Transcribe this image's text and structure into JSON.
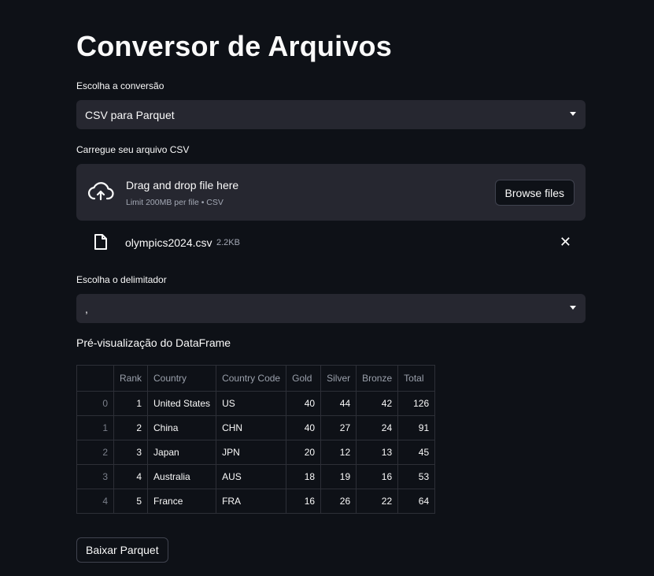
{
  "page": {
    "title": "Conversor de Arquivos"
  },
  "conversion": {
    "label": "Escolha a conversão",
    "value": "CSV para Parquet"
  },
  "upload": {
    "label": "Carregue seu arquivo CSV",
    "drop_text": "Drag and drop file here",
    "limit_text": "Limit 200MB per file • CSV",
    "browse_label": "Browse files",
    "file_name": "olympics2024.csv",
    "file_size": "2.2KB",
    "remove_symbol": "✕"
  },
  "delimiter": {
    "label": "Escolha o delimitador",
    "value": ","
  },
  "preview": {
    "title": "Pré-visualização do DataFrame",
    "columns": [
      "",
      "Rank",
      "Country",
      "Country Code",
      "Gold",
      "Silver",
      "Bronze",
      "Total"
    ],
    "rows": [
      [
        "0",
        "1",
        "United States",
        "US",
        "40",
        "44",
        "42",
        "126"
      ],
      [
        "1",
        "2",
        "China",
        "CHN",
        "40",
        "27",
        "24",
        "91"
      ],
      [
        "2",
        "3",
        "Japan",
        "JPN",
        "20",
        "12",
        "13",
        "45"
      ],
      [
        "3",
        "4",
        "Australia",
        "AUS",
        "18",
        "19",
        "16",
        "53"
      ],
      [
        "4",
        "5",
        "France",
        "FRA",
        "16",
        "26",
        "22",
        "64"
      ]
    ]
  },
  "download": {
    "label": "Baixar Parquet"
  },
  "icons": {
    "upload": "cloud-upload-icon",
    "file": "file-icon",
    "caret": "chevron-down-icon",
    "close": "close-icon"
  },
  "colors": {
    "background": "#0e1117",
    "input": "#262730",
    "text": "#fafafa",
    "muted": "#a3a8b4"
  }
}
